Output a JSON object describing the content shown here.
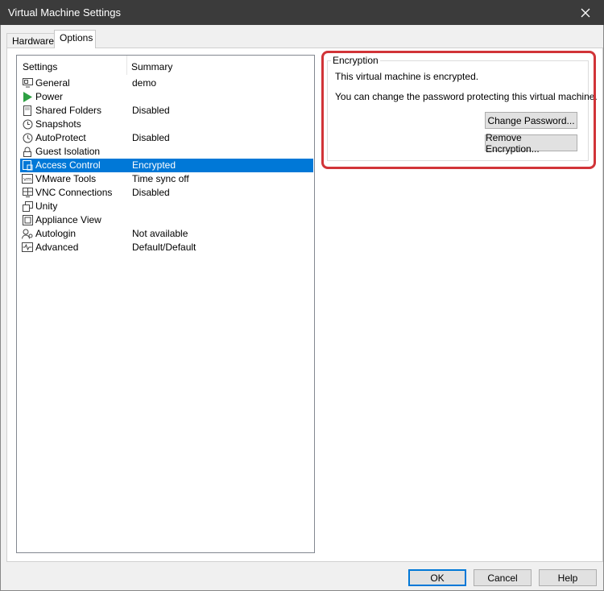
{
  "window": {
    "title": "Virtual Machine Settings",
    "close_glyph": "✕"
  },
  "tabs": [
    {
      "label": "Hardware",
      "selected": false
    },
    {
      "label": "Options",
      "selected": true
    }
  ],
  "settings_list": {
    "col_settings": "Settings",
    "col_summary": "Summary",
    "selected_color": "#0078d7",
    "items": [
      {
        "icon": "monitor-icon",
        "glyph": "▭",
        "label": "General",
        "summary": "demo"
      },
      {
        "icon": "power-play-icon",
        "glyph": "▶",
        "label": "Power",
        "summary": ""
      },
      {
        "icon": "shared-folder-icon",
        "glyph": "▯",
        "label": "Shared Folders",
        "summary": "Disabled"
      },
      {
        "icon": "snapshot-clock-icon",
        "glyph": "◔",
        "label": "Snapshots",
        "summary": ""
      },
      {
        "icon": "autoprotect-clock-icon",
        "glyph": "◷",
        "label": "AutoProtect",
        "summary": "Disabled"
      },
      {
        "icon": "lock-icon",
        "glyph": "⊓",
        "label": "Guest Isolation",
        "summary": ""
      },
      {
        "icon": "access-control-icon",
        "glyph": "⧉",
        "label": "Access Control",
        "summary": "Encrypted"
      },
      {
        "icon": "vmware-tools-icon",
        "glyph": "vm",
        "label": "VMware Tools",
        "summary": "Time sync off"
      },
      {
        "icon": "vnc-connections-icon",
        "glyph": "⊞",
        "label": "VNC Connections",
        "summary": "Disabled"
      },
      {
        "icon": "unity-icon",
        "glyph": "⧠",
        "label": "Unity",
        "summary": ""
      },
      {
        "icon": "appliance-view-icon",
        "glyph": "⊡",
        "label": "Appliance View",
        "summary": ""
      },
      {
        "icon": "autologin-user-icon",
        "glyph": "⚲",
        "label": "Autologin",
        "summary": "Not available"
      },
      {
        "icon": "advanced-pulse-icon",
        "glyph": "∿",
        "label": "Advanced",
        "summary": "Default/Default"
      }
    ]
  },
  "encryption": {
    "group_label": "Encryption",
    "status_text": "This virtual machine is encrypted.",
    "info_text": "You can change the password protecting this virtual machine.",
    "change_password_label": "Change Password...",
    "remove_encryption_label": "Remove Encryption...",
    "highlight_color": "#d13438"
  },
  "footer": {
    "ok_label": "OK",
    "cancel_label": "Cancel",
    "help_label": "Help"
  }
}
